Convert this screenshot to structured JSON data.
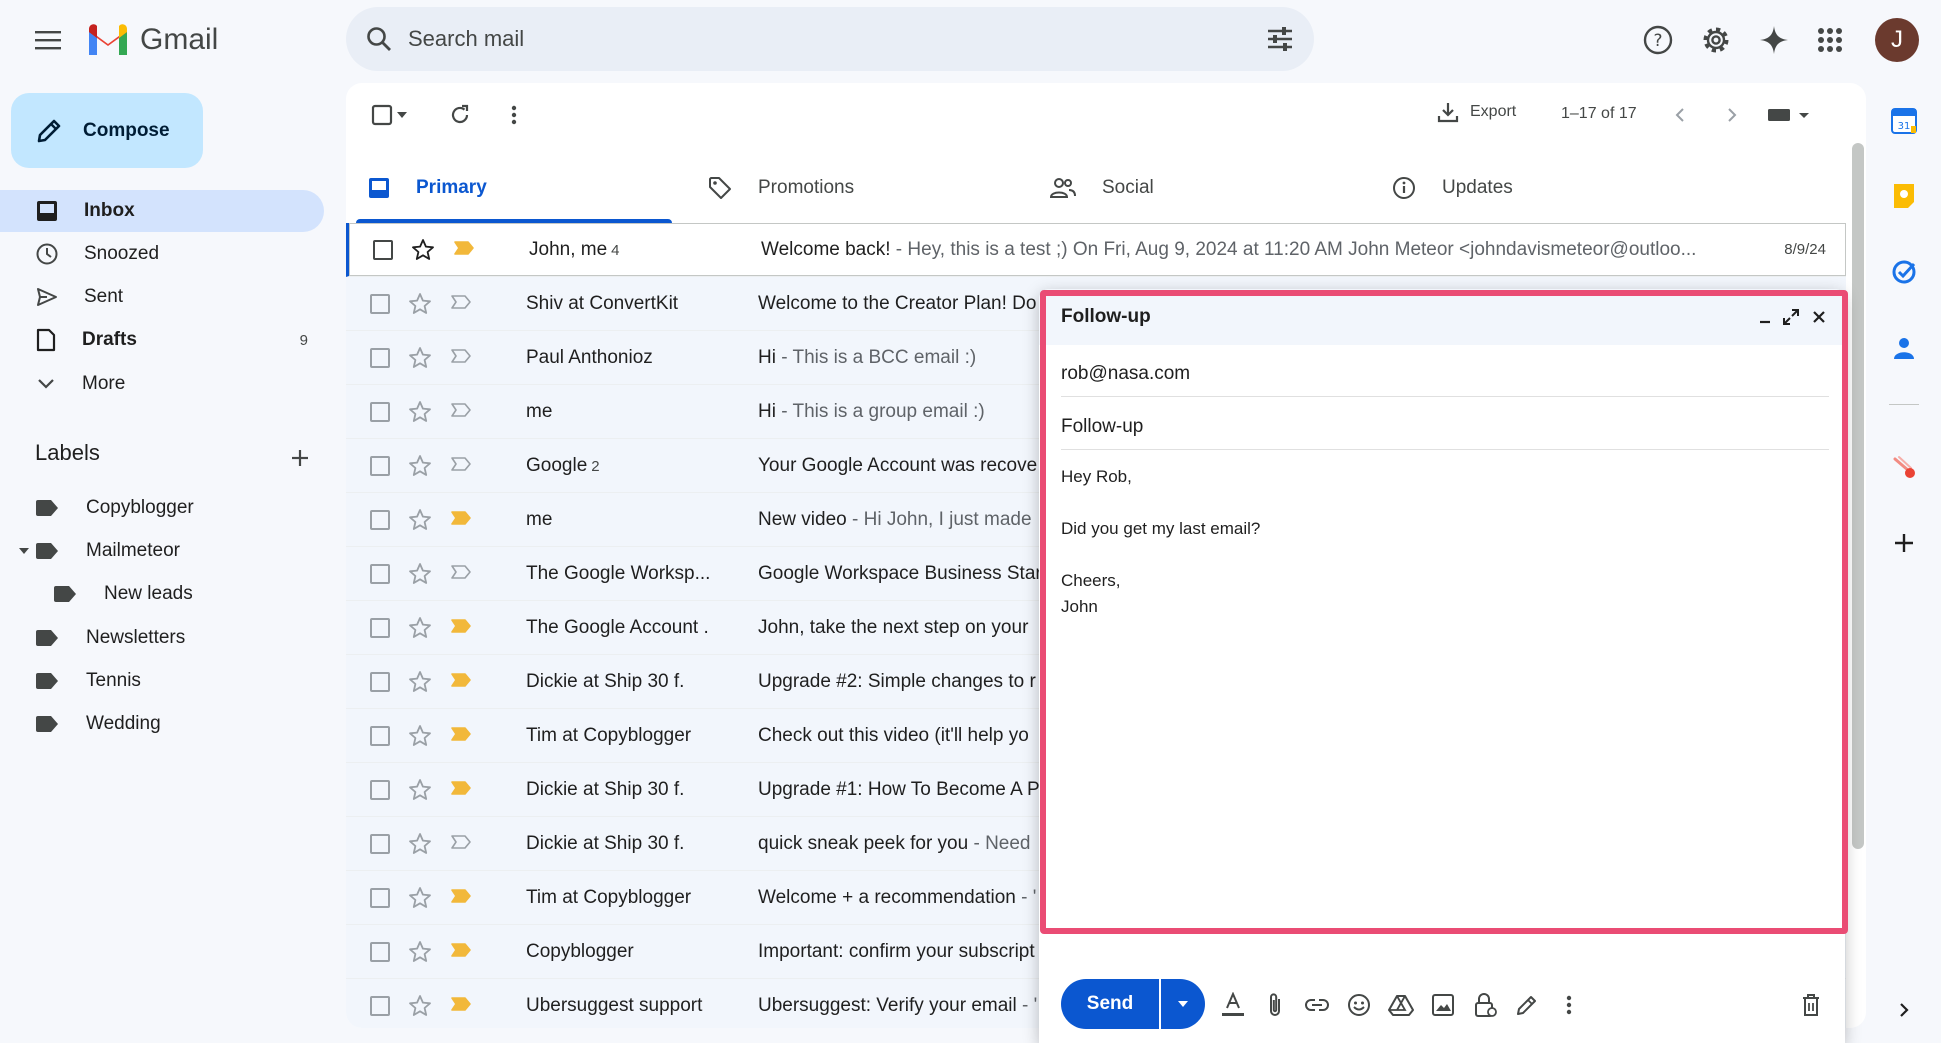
{
  "app": {
    "name": "Gmail"
  },
  "search": {
    "placeholder": "Search mail"
  },
  "user": {
    "avatar_letter": "J",
    "avatar_color": "#6b3a2e"
  },
  "compose_button": {
    "label": "Compose"
  },
  "nav": [
    {
      "label": "Inbox",
      "count": "",
      "active": true,
      "icon": "inbox-icon"
    },
    {
      "label": "Snoozed",
      "count": "",
      "active": false,
      "icon": "clock-icon"
    },
    {
      "label": "Sent",
      "count": "",
      "active": false,
      "icon": "send-icon"
    },
    {
      "label": "Drafts",
      "count": "9",
      "active": false,
      "icon": "draft-icon"
    },
    {
      "label": "More",
      "count": "",
      "active": false,
      "icon": "chevron-down-icon"
    }
  ],
  "labels": {
    "header": "Labels",
    "items": [
      {
        "label": "Copyblogger"
      },
      {
        "label": "Mailmeteor"
      },
      {
        "label": "New leads"
      },
      {
        "label": "Newsletters"
      },
      {
        "label": "Tennis"
      },
      {
        "label": "Wedding"
      }
    ]
  },
  "toolbar": {
    "export_label": "Export",
    "page_count": "1–17 of 17"
  },
  "tabs": [
    {
      "label": "Primary",
      "icon": "inbox-icon",
      "active": true
    },
    {
      "label": "Promotions",
      "icon": "tag-icon",
      "active": false
    },
    {
      "label": "Social",
      "icon": "people-icon",
      "active": false
    },
    {
      "label": "Updates",
      "icon": "info-icon",
      "active": false
    }
  ],
  "emails": [
    {
      "sender": "John, me",
      "count": "4",
      "subject": "Welcome back!",
      "snippet": " - Hey, this is a test ;) On Fri, Aug 9, 2024 at 11:20 AM John Meteor <johndavismeteor@outloo...",
      "date": "8/9/24",
      "important": true,
      "unread": true
    },
    {
      "sender": "Shiv at ConvertKit",
      "count": "",
      "subject": "Welcome to the Creator Plan! Do",
      "snippet": "",
      "date": "",
      "important": false,
      "unread": false
    },
    {
      "sender": "Paul Anthonioz",
      "count": "",
      "subject": "Hi",
      "snippet": " - This is a BCC email :)",
      "date": "",
      "important": false,
      "unread": false
    },
    {
      "sender": "me",
      "count": "",
      "subject": "Hi",
      "snippet": " - This is a group email :)",
      "date": "",
      "important": false,
      "unread": false
    },
    {
      "sender": "Google",
      "count": "2",
      "subject": "Your Google Account was recove",
      "snippet": "",
      "date": "",
      "important": false,
      "unread": false
    },
    {
      "sender": "me",
      "count": "",
      "subject": "New video",
      "snippet": " - Hi John, I just made",
      "date": "",
      "important": true,
      "unread": false
    },
    {
      "sender": "The Google Worksp...",
      "count": "",
      "subject": "Google Workspace Business Star",
      "snippet": "",
      "date": "",
      "important": false,
      "unread": false
    },
    {
      "sender": "The Google Account .",
      "count": "",
      "subject": "John, take the next step on your",
      "snippet": "",
      "date": "",
      "important": true,
      "unread": false
    },
    {
      "sender": "Dickie at Ship 30 f.",
      "count": "",
      "subject": "Upgrade #2: Simple changes to r",
      "snippet": "",
      "date": "",
      "important": true,
      "unread": false
    },
    {
      "sender": "Tim at Copyblogger",
      "count": "",
      "subject": "Check out this video (it'll help yo",
      "snippet": "",
      "date": "",
      "important": true,
      "unread": false
    },
    {
      "sender": "Dickie at Ship 30 f.",
      "count": "",
      "subject": "Upgrade #1: How To Become A P",
      "snippet": "",
      "date": "",
      "important": true,
      "unread": false
    },
    {
      "sender": "Dickie at Ship 30 f.",
      "count": "",
      "subject": "quick sneak peek for you",
      "snippet": " - Need",
      "date": "",
      "important": false,
      "unread": false
    },
    {
      "sender": "Tim at Copyblogger",
      "count": "",
      "subject": "Welcome + a recommendation",
      "snippet": " - '",
      "date": "",
      "important": true,
      "unread": false
    },
    {
      "sender": "Copyblogger",
      "count": "",
      "subject": "Important: confirm your subscript",
      "snippet": "",
      "date": "",
      "important": true,
      "unread": false
    },
    {
      "sender": "Ubersuggest support",
      "count": "",
      "subject": "Ubersuggest: Verify your email",
      "snippet": " - '",
      "date": "",
      "important": true,
      "unread": false
    }
  ],
  "compose_window": {
    "title": "Follow-up",
    "to": "rob@nasa.com",
    "subject": "Follow-up",
    "body": [
      "Hey Rob,",
      "",
      "Did you get my last email?",
      "",
      "Cheers,",
      "John"
    ],
    "send_label": "Send",
    "highlight_color": "#ea4c74"
  },
  "colors": {
    "accent": "#0b57d0",
    "important": "#f2b83a",
    "compose_bg": "#c2e7ff"
  }
}
